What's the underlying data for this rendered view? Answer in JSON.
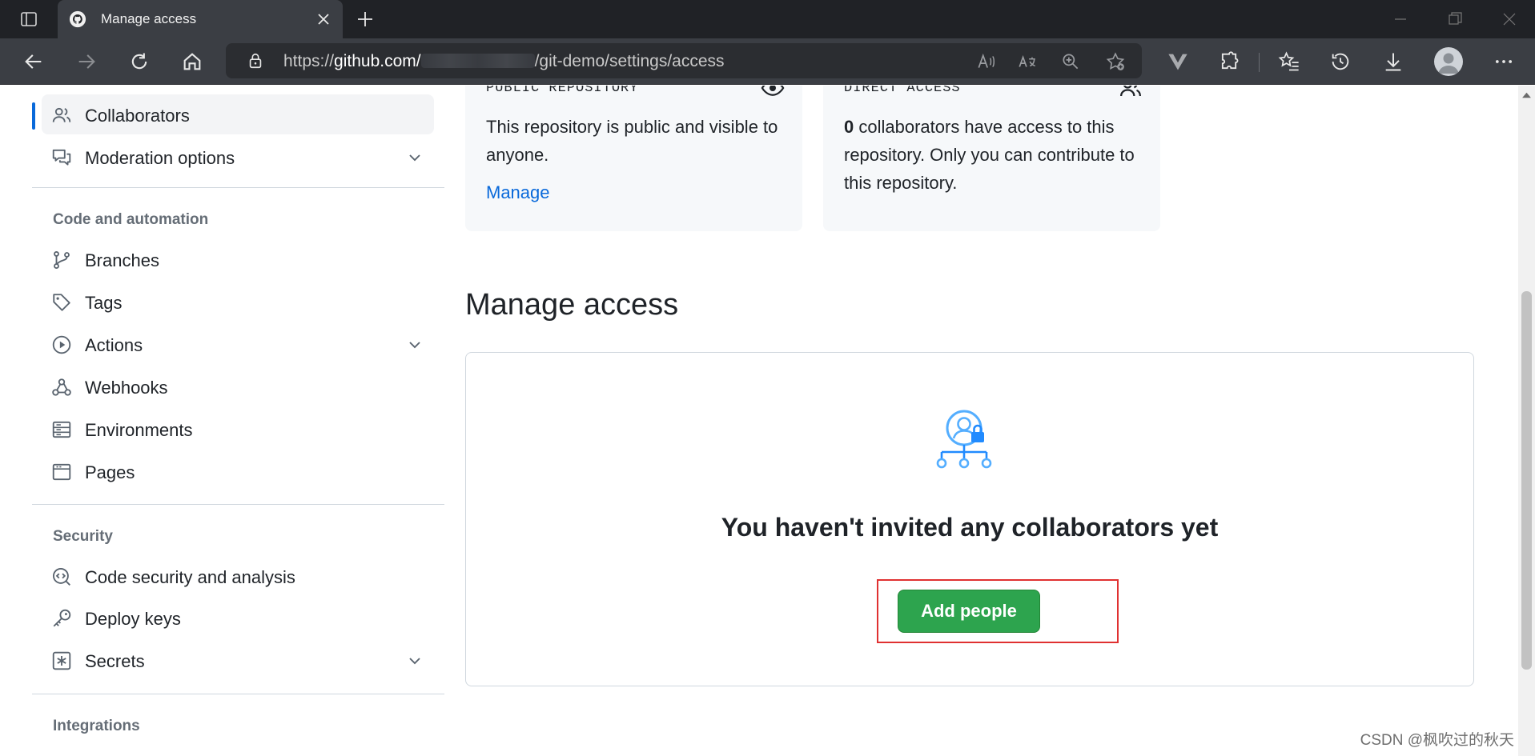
{
  "browser": {
    "tab_title": "Manage access",
    "url_prefix": "https://",
    "url_host": "github.com/",
    "url_path": "/git-demo/settings/access"
  },
  "sidebar": {
    "items_top": [
      {
        "label": "Collaborators",
        "icon": "people-icon",
        "active": true
      },
      {
        "label": "Moderation options",
        "icon": "comment-discussion-icon",
        "expandable": true
      }
    ],
    "sections": [
      {
        "heading": "Code and automation",
        "items": [
          {
            "label": "Branches",
            "icon": "git-branch-icon"
          },
          {
            "label": "Tags",
            "icon": "tag-icon"
          },
          {
            "label": "Actions",
            "icon": "play-icon",
            "expandable": true
          },
          {
            "label": "Webhooks",
            "icon": "webhook-icon"
          },
          {
            "label": "Environments",
            "icon": "server-icon"
          },
          {
            "label": "Pages",
            "icon": "browser-icon"
          }
        ]
      },
      {
        "heading": "Security",
        "items": [
          {
            "label": "Code security and analysis",
            "icon": "codescan-icon"
          },
          {
            "label": "Deploy keys",
            "icon": "key-icon"
          },
          {
            "label": "Secrets",
            "icon": "asterisk-icon",
            "expandable": true
          }
        ]
      },
      {
        "heading": "Integrations",
        "items": []
      }
    ]
  },
  "cards": [
    {
      "heading": "PUBLIC REPOSITORY",
      "icon": "eye-icon",
      "text": "This repository is public and visible to anyone.",
      "link": "Manage"
    },
    {
      "heading": "DIRECT ACCESS",
      "icon": "people-icon",
      "count": "0",
      "text": " collaborators have access to this repository. Only you can contribute to this repository."
    }
  ],
  "main": {
    "title": "Manage access",
    "empty_title": "You haven't invited any collaborators yet",
    "add_button": "Add people"
  },
  "watermark": "CSDN @枫吹过的秋天",
  "colors": {
    "accent": "#0969da",
    "primary_button": "#2da44e",
    "highlight": "#e03131"
  }
}
